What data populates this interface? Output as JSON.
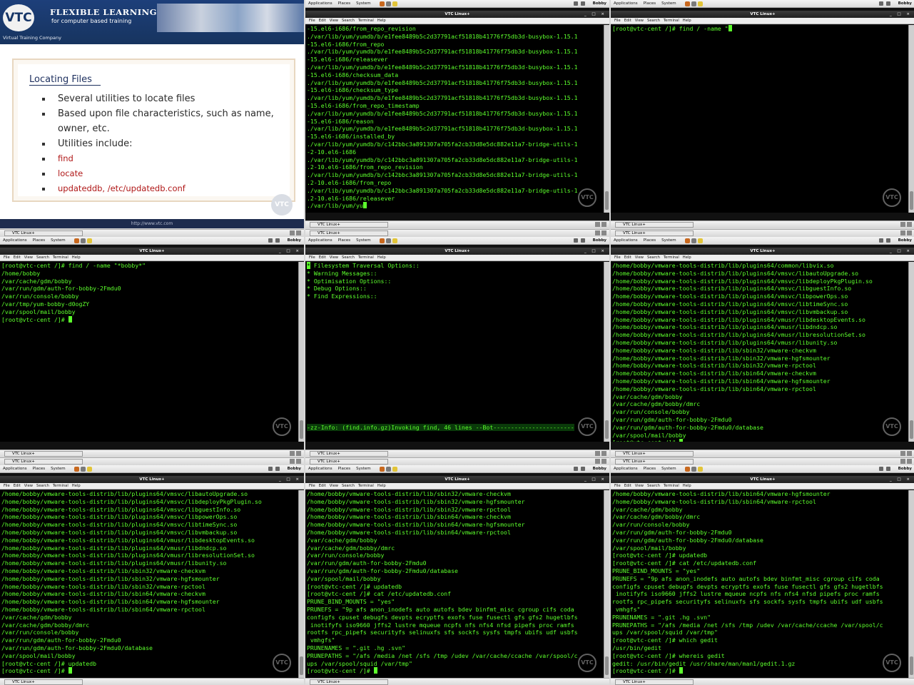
{
  "slide": {
    "logo_text": "VTC",
    "brand_title": "FLEXIBLE LEARNING",
    "brand_sub": "for computer based training",
    "tagline": "Virtual Training Company",
    "heading": "Locating Files",
    "bullets": [
      "Several utilities to locate files",
      "Based upon file characteristics, such as name, owner, etc.",
      "Utilities include:"
    ],
    "sub_bullets": [
      "find",
      "locate",
      "updateddb, /etc/updatedb.conf"
    ],
    "footer_url": "http://www.vtc.com",
    "watermark": "VTC"
  },
  "desktop": {
    "top_menus": [
      "Applications",
      "Places",
      "System"
    ],
    "user": "Bobby",
    "window_title": "VTC Linux+",
    "task_label": "VTC Linux+",
    "menus": [
      "File",
      "Edit",
      "View",
      "Search",
      "Terminal",
      "Help"
    ],
    "window_buttons": "_ □ ×",
    "watermark": "VTC"
  },
  "terminals": {
    "t1": [
      "-15.el6-i686/from_repo_revision",
      "./var/lib/yum/yumdb/b/e1fee8489b5c2d37791acf51818b41776f75db3d-busybox-1.15.1",
      "-15.el6-i686/from_repo",
      "./var/lib/yum/yumdb/b/e1fee8489b5c2d37791acf51818b41776f75db3d-busybox-1.15.1",
      "-15.el6-i686/releasever",
      "./var/lib/yum/yumdb/b/e1fee8489b5c2d37791acf51818b41776f75db3d-busybox-1.15.1",
      "-15.el6-i686/checksum_data",
      "./var/lib/yum/yumdb/b/e1fee8489b5c2d37791acf51818b41776f75db3d-busybox-1.15.1",
      "-15.el6-i686/checksum_type",
      "./var/lib/yum/yumdb/b/e1fee8489b5c2d37791acf51818b41776f75db3d-busybox-1.15.1",
      "-15.el6-i686/from_repo_timestamp",
      "./var/lib/yum/yumdb/b/e1fee8489b5c2d37791acf51818b41776f75db3d-busybox-1.15.1",
      "-15.el6-i686/reason",
      "./var/lib/yum/yumdb/b/e1fee8489b5c2d37791acf51818b41776f75db3d-busybox-1.15.1",
      "-15.el6-i686/installed_by",
      "./var/lib/yum/yumdb/b/c142bbc3a891307a705fa2cb33d8e5dc882e11a7-bridge-utils-1",
      "-2-10.el6-i686",
      "./var/lib/yum/yumdb/b/c142bbc3a891307a705fa2cb33d8e5dc882e11a7-bridge-utils-1",
      ".2-10.el6-i686/from_repo_revision",
      "./var/lib/yum/yumdb/b/c142bbc3a891307a705fa2cb33d8e5dc882e11a7-bridge-utils-1",
      ".2-10.el6-i686/from_repo",
      "./var/lib/yum/yumdb/b/c142bbc3a891307a705fa2cb33d8e5dc882e11a7-bridge-utils-1",
      ".2-10.el6-i686/releasever",
      "./var/lib/yum/yu"
    ],
    "t2": [
      "[root@vtc-cent /]# find / -name \""
    ],
    "t3": [
      "[root@vtc-cent /]# find / -name \"*bobby*\"",
      "/home/bobby",
      "/var/cache/gdm/bobby",
      "/var/run/gdm/auth-for-bobby-2Fmdu0",
      "/var/run/console/bobby",
      "/var/tmp/yum-bobby-d0ogZY",
      "/var/spool/mail/bobby",
      "[root@vtc-cent /]# "
    ],
    "t4": [
      "* Filesystem Traversal Options::",
      "* Warning Messages::",
      "* Optimisation Options::",
      "* Debug Options::",
      "* Find Expressions::"
    ],
    "t4_status": "-zz-Info: (find.info.gz)Invoking find, 46 lines --Bot-----------------------",
    "t5": [
      "/home/bobby/vmware-tools-distrib/lib/plugins64/common/libvix.so",
      "/home/bobby/vmware-tools-distrib/lib/plugins64/vmsvc/libautoUpgrade.so",
      "/home/bobby/vmware-tools-distrib/lib/plugins64/vmsvc/libdeployPkgPlugin.so",
      "/home/bobby/vmware-tools-distrib/lib/plugins64/vmsvc/libguestInfo.so",
      "/home/bobby/vmware-tools-distrib/lib/plugins64/vmsvc/libpowerOps.so",
      "/home/bobby/vmware-tools-distrib/lib/plugins64/vmsvc/libtimeSync.so",
      "/home/bobby/vmware-tools-distrib/lib/plugins64/vmsvc/libvmbackup.so",
      "/home/bobby/vmware-tools-distrib/lib/plugins64/vmusr/libdesktopEvents.so",
      "/home/bobby/vmware-tools-distrib/lib/plugins64/vmusr/libdndcp.so",
      "/home/bobby/vmware-tools-distrib/lib/plugins64/vmusr/libresolutionSet.so",
      "/home/bobby/vmware-tools-distrib/lib/plugins64/vmusr/libunity.so",
      "/home/bobby/vmware-tools-distrib/lib/sbin32/vmware-checkvm",
      "/home/bobby/vmware-tools-distrib/lib/sbin32/vmware-hgfsmounter",
      "/home/bobby/vmware-tools-distrib/lib/sbin32/vmware-rpctool",
      "/home/bobby/vmware-tools-distrib/lib/sbin64/vmware-checkvm",
      "/home/bobby/vmware-tools-distrib/lib/sbin64/vmware-hgfsmounter",
      "/home/bobby/vmware-tools-distrib/lib/sbin64/vmware-rpctool",
      "/var/cache/gdm/bobby",
      "/var/cache/gdm/bobby/dmrc",
      "/var/run/console/bobby",
      "/var/run/gdm/auth-for-bobby-2Fmdu0",
      "/var/run/gdm/auth-for-bobby-2Fmdu0/database",
      "/var/spool/mail/bobby",
      "[root@vtc-cent /]# "
    ],
    "t6": [
      "/home/bobby/vmware-tools-distrib/lib/plugins64/vmsvc/libautoUpgrade.so",
      "/home/bobby/vmware-tools-distrib/lib/plugins64/vmsvc/libdeployPkgPlugin.so",
      "/home/bobby/vmware-tools-distrib/lib/plugins64/vmsvc/libguestInfo.so",
      "/home/bobby/vmware-tools-distrib/lib/plugins64/vmsvc/libpowerOps.so",
      "/home/bobby/vmware-tools-distrib/lib/plugins64/vmsvc/libtimeSync.so",
      "/home/bobby/vmware-tools-distrib/lib/plugins64/vmsvc/libvmbackup.so",
      "/home/bobby/vmware-tools-distrib/lib/plugins64/vmusr/libdesktopEvents.so",
      "/home/bobby/vmware-tools-distrib/lib/plugins64/vmusr/libdndcp.so",
      "/home/bobby/vmware-tools-distrib/lib/plugins64/vmusr/libresolutionSet.so",
      "/home/bobby/vmware-tools-distrib/lib/plugins64/vmusr/libunity.so",
      "/home/bobby/vmware-tools-distrib/lib/sbin32/vmware-checkvm",
      "/home/bobby/vmware-tools-distrib/lib/sbin32/vmware-hgfsmounter",
      "/home/bobby/vmware-tools-distrib/lib/sbin32/vmware-rpctool",
      "/home/bobby/vmware-tools-distrib/lib/sbin64/vmware-checkvm",
      "/home/bobby/vmware-tools-distrib/lib/sbin64/vmware-hgfsmounter",
      "/home/bobby/vmware-tools-distrib/lib/sbin64/vmware-rpctool",
      "/var/cache/gdm/bobby",
      "/var/cache/gdm/bobby/dmrc",
      "/var/run/console/bobby",
      "/var/run/gdm/auth-for-bobby-2Fmdu0",
      "/var/run/gdm/auth-for-bobby-2Fmdu0/database",
      "/var/spool/mail/bobby",
      "[root@vtc-cent /]# updatedb",
      "[root@vtc-cent /]# "
    ],
    "t7": [
      "/home/bobby/vmware-tools-distrib/lib/sbin32/vmware-checkvm",
      "/home/bobby/vmware-tools-distrib/lib/sbin32/vmware-hgfsmounter",
      "/home/bobby/vmware-tools-distrib/lib/sbin32/vmware-rpctool",
      "/home/bobby/vmware-tools-distrib/lib/sbin64/vmware-checkvm",
      "/home/bobby/vmware-tools-distrib/lib/sbin64/vmware-hgfsmounter",
      "/home/bobby/vmware-tools-distrib/lib/sbin64/vmware-rpctool",
      "/var/cache/gdm/bobby",
      "/var/cache/gdm/bobby/dmrc",
      "/var/run/console/bobby",
      "/var/run/gdm/auth-for-bobby-2Fmdu0",
      "/var/run/gdm/auth-for-bobby-2Fmdu0/database",
      "/var/spool/mail/bobby",
      "[root@vtc-cent /]# updatedb",
      "[root@vtc-cent /]# cat /etc/updatedb.conf",
      "PRUNE_BIND_MOUNTS = \"yes\"",
      "PRUNEFS = \"9p afs anon_inodefs auto autofs bdev binfmt_misc cgroup cifs coda",
      "configfs cpuset debugfs devpts ecryptfs exofs fuse fusectl gfs gfs2 hugetlbfs",
      " inotifyfs iso9660 jffs2 lustre mqueue ncpfs nfs nfs4 nfsd pipefs proc ramfs",
      "rootfs rpc_pipefs securityfs selinuxfs sfs sockfs sysfs tmpfs ubifs udf usbfs",
      " vmhgfs\"",
      "PRUNENAMES = \".git .hg .svn\"",
      "PRUNEPATHS = \"/afs /media /net /sfs /tmp /udev /var/cache/ccache /var/spool/c",
      "ups /var/spool/squid /var/tmp\"",
      "[root@vtc-cent /]# "
    ],
    "t8": [
      "/home/bobby/vmware-tools-distrib/lib/sbin64/vmware-hgfsmounter",
      "/home/bobby/vmware-tools-distrib/lib/sbin64/vmware-rpctool",
      "/var/cache/gdm/bobby",
      "/var/cache/gdm/bobby/dmrc",
      "/var/run/console/bobby",
      "/var/run/gdm/auth-for-bobby-2Fmdu0",
      "/var/run/gdm/auth-for-bobby-2Fmdu0/database",
      "/var/spool/mail/bobby",
      "[root@vtc-cent /]# updatedb",
      "[root@vtc-cent /]# cat /etc/updatedb.conf",
      "PRUNE_BIND_MOUNTS = \"yes\"",
      "PRUNEFS = \"9p afs anon_inodefs auto autofs bdev binfmt_misc cgroup cifs coda",
      "configfs cpuset debugfs devpts ecryptfs exofs fuse fusectl gfs gfs2 hugetlbfs",
      " inotifyfs iso9660 jffs2 lustre mqueue ncpfs nfs nfs4 nfsd pipefs proc ramfs",
      "rootfs rpc_pipefs securityfs selinuxfs sfs sockfs sysfs tmpfs ubifs udf usbfs",
      " vmhgfs\"",
      "PRUNENAMES = \".git .hg .svn\"",
      "PRUNEPATHS = \"/afs /media /net /sfs /tmp /udev /var/cache/ccache /var/spool/c",
      "ups /var/spool/squid /var/tmp\"",
      "[root@vtc-cent /]# which gedit",
      "/usr/bin/gedit",
      "[root@vtc-cent /]# whereis gedit",
      "gedit: /usr/bin/gedit /usr/share/man/man1/gedit.1.gz",
      "[root@vtc-cent /]# "
    ]
  },
  "colors": {
    "terminal_fg": "#5cff2c",
    "terminal_bg": "#000000",
    "slide_heading": "#1d2f5e",
    "sub_bullet": "#b01818"
  }
}
